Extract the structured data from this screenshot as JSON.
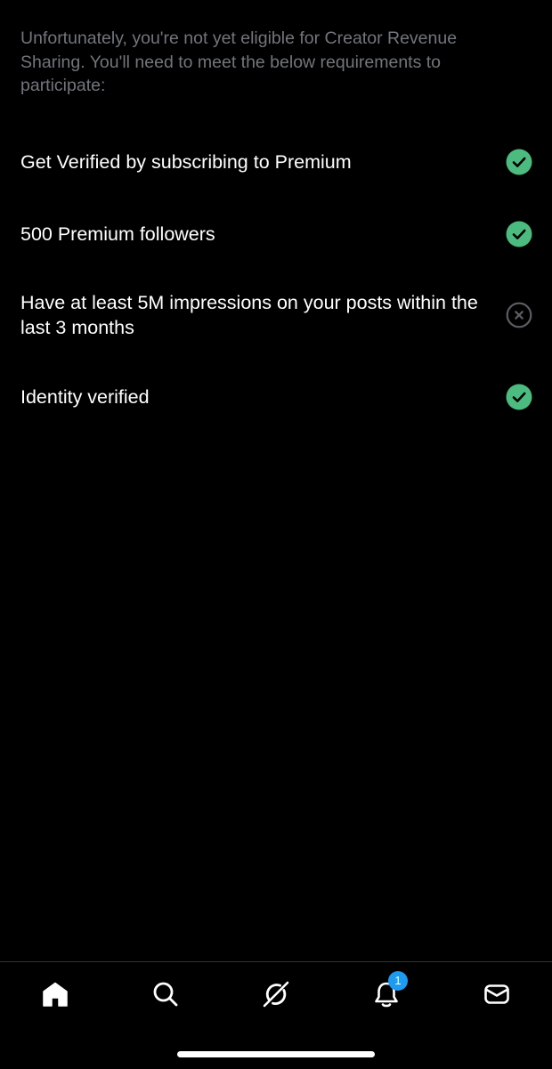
{
  "intro_text": "Unfortunately, you're not yet eligible for Creator Revenue Sharing. You'll need to meet the below requirements to participate:",
  "requirements": [
    {
      "label": "Get Verified by subscribing to Premium",
      "status": "met",
      "icon": "check-circle-icon"
    },
    {
      "label": "500 Premium followers",
      "status": "met",
      "icon": "check-circle-icon"
    },
    {
      "label": "Have at least 5M impressions on your posts within the last 3 months",
      "status": "not-met",
      "icon": "x-circle-icon"
    },
    {
      "label": "Identity verified",
      "status": "met",
      "icon": "check-circle-icon"
    }
  ],
  "colors": {
    "met": "#4cbb7f",
    "not_met": "#5b5f63",
    "accent": "#1d9bf0",
    "muted_text": "#71767b"
  },
  "bottom_nav": {
    "items": [
      "home-icon",
      "search-icon",
      "grok-icon",
      "bell-icon",
      "mail-icon"
    ],
    "notifications_badge": "1"
  }
}
